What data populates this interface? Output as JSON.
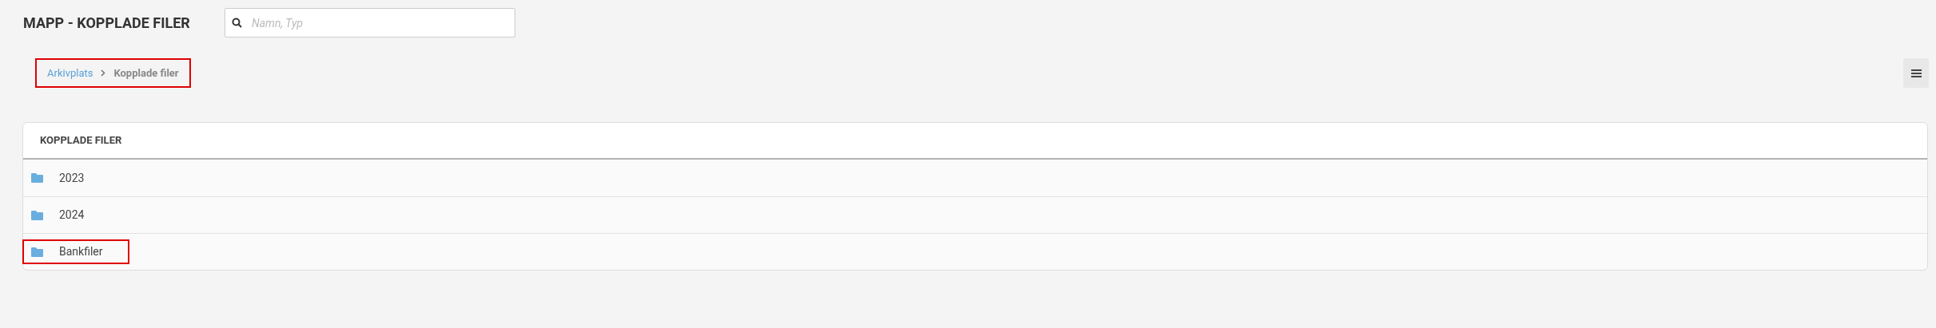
{
  "header": {
    "title": "MAPP - KOPPLADE FILER",
    "search": {
      "placeholder": "Namn, Typ"
    }
  },
  "breadcrumb": {
    "highlighted": true,
    "items": [
      {
        "label": "Arkivplats",
        "kind": "link"
      },
      {
        "label": "Kopplade filer",
        "kind": "current"
      }
    ]
  },
  "panel": {
    "title": "KOPPLADE FILER",
    "rows": [
      {
        "name": "2023",
        "highlighted": false
      },
      {
        "name": "2024",
        "highlighted": false
      },
      {
        "name": "Bankfiler",
        "highlighted": true
      }
    ]
  }
}
